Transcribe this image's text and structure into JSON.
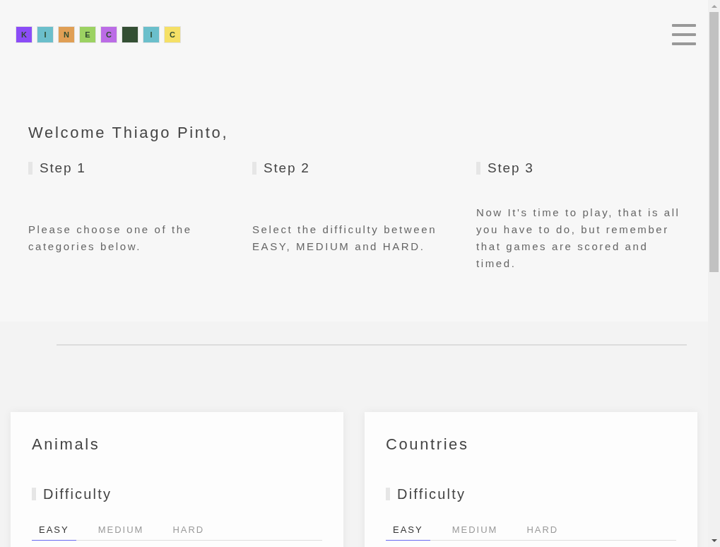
{
  "logo": {
    "tiles": [
      {
        "letter": "K",
        "color": "#8b4cf7"
      },
      {
        "letter": "I",
        "color": "#6bbfcb"
      },
      {
        "letter": "N",
        "color": "#e09f55"
      },
      {
        "letter": "E",
        "color": "#9cd262"
      },
      {
        "letter": "C",
        "color": "#bb6ce6"
      },
      {
        "color": "#344f34"
      },
      {
        "letter": "I",
        "color": "#6bbfcb"
      },
      {
        "letter": "C",
        "color": "#f5e066"
      }
    ]
  },
  "welcome": "Welcome Thiago Pinto,",
  "steps": [
    {
      "title": "Step 1",
      "text": "Please choose one of the categories below."
    },
    {
      "title": "Step 2",
      "text": "Select the difficulty between EASY, MEDIUM and HARD."
    },
    {
      "title": "Step 3",
      "text": "Now It's time to play, that is all you have to do, but remember that games are scored and timed."
    }
  ],
  "categories": [
    {
      "title": "Animals",
      "difficulty_label": "Difficulty",
      "tabs": [
        {
          "label": "EASY",
          "selected": true
        },
        {
          "label": "MEDIUM",
          "selected": false
        },
        {
          "label": "HARD",
          "selected": false
        }
      ]
    },
    {
      "title": "Countries",
      "difficulty_label": "Difficulty",
      "tabs": [
        {
          "label": "EASY",
          "selected": true
        },
        {
          "label": "MEDIUM",
          "selected": false
        },
        {
          "label": "HARD",
          "selected": false
        }
      ]
    }
  ]
}
